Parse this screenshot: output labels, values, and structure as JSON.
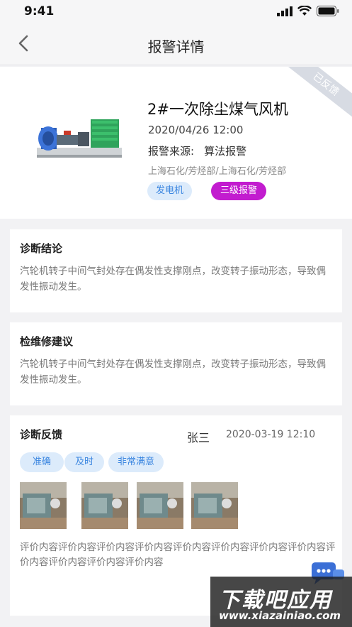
{
  "status_bar": {
    "time": "9:41"
  },
  "nav": {
    "title": "报警详情"
  },
  "alarm": {
    "equipment_name": "2#一次除尘煤气风机",
    "time": "2020/04/26 12:00",
    "source_label": "报警来源:",
    "source_value": "算法报警",
    "location_path": "上海石化/芳烃部/上海石化/芳烃部",
    "type_tag": "发电机",
    "level_tag": "三级报警",
    "feedback_ribbon": "已反馈"
  },
  "diagnosis": {
    "title": "诊断结论",
    "text": "汽轮机转子中间气封处存在偶发性支撑刚点，改变转子振动形态，导致偶发性振动发生。"
  },
  "maintenance": {
    "title": "检维修建议",
    "text": "汽轮机转子中间气封处存在偶发性支撑刚点，改变转子振动形态，导致偶发性振动发生。"
  },
  "feedback": {
    "title": "诊断反馈",
    "user": "张三",
    "time": "2020-03-19 12:10",
    "chips": [
      "准确",
      "及时",
      "非常满意"
    ],
    "photo_count": 4,
    "comment": "评价内容评价内容评价内容评价内容评价内容评价内容评价内容评价内容评价内容评价内容评价内容评价内容"
  },
  "watermark": {
    "brand": "下载吧应用",
    "url": "www.xiazainiao.com"
  },
  "colors": {
    "blue_tag_bg": "#dcebfb",
    "blue_tag_text": "#3b86e0",
    "level_tag_bg": "#c21ccf"
  }
}
